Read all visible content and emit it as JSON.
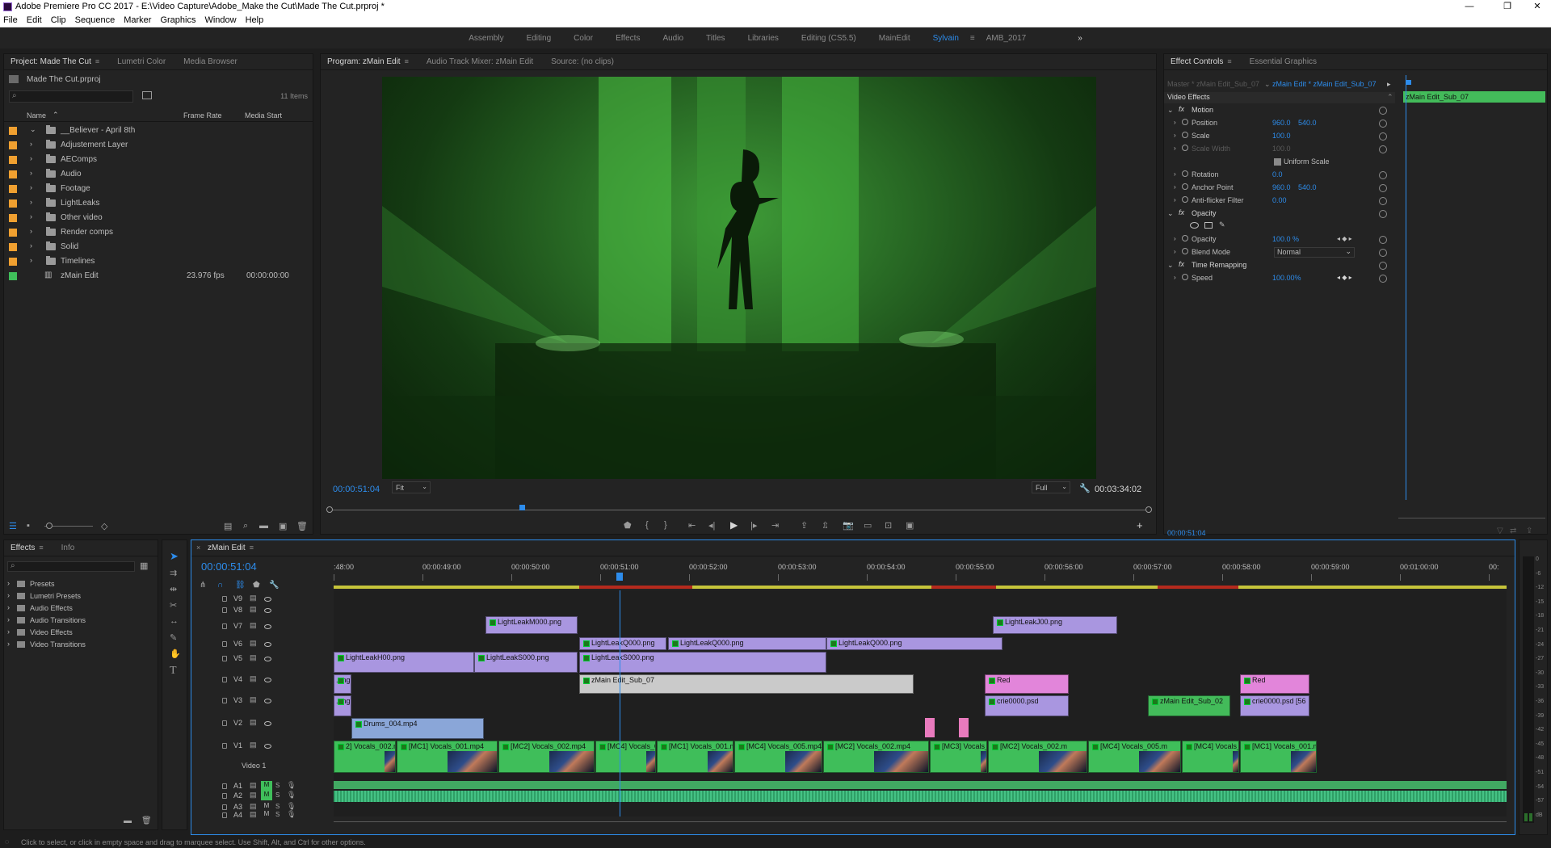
{
  "window": {
    "title": "Adobe Premiere Pro CC 2017 - E:\\Video Capture\\Adobe_Make the Cut\\Made The Cut.prproj *",
    "controls": [
      "—",
      "❐",
      "✕"
    ]
  },
  "menu": [
    "File",
    "Edit",
    "Clip",
    "Sequence",
    "Marker",
    "Graphics",
    "Window",
    "Help"
  ],
  "workspaces": {
    "items": [
      "Assembly",
      "Editing",
      "Color",
      "Effects",
      "Audio",
      "Titles",
      "Libraries",
      "Editing (CS5.5)",
      "MainEdit",
      "Sylvain",
      "AMB_2017"
    ],
    "active": "Sylvain",
    "more": "»"
  },
  "project": {
    "tabs": [
      "Project: Made The Cut",
      "Lumetri Color",
      "Media Browser"
    ],
    "file": "Made The Cut.prproj",
    "items_count": "11 Items",
    "columns": [
      "Name",
      "Frame Rate",
      "Media Start"
    ],
    "rows": [
      {
        "name": "__Believer - April 8th",
        "color": "#f0a030",
        "fps": "",
        "start": "",
        "expanded": true
      },
      {
        "name": "Adjustement Layer",
        "color": "#f0a030",
        "fps": "",
        "start": ""
      },
      {
        "name": "AEComps",
        "color": "#f0a030",
        "fps": "",
        "start": ""
      },
      {
        "name": "Audio",
        "color": "#f0a030",
        "fps": "",
        "start": ""
      },
      {
        "name": "Footage",
        "color": "#f0a030",
        "fps": "",
        "start": ""
      },
      {
        "name": "LightLeaks",
        "color": "#f0a030",
        "fps": "",
        "start": ""
      },
      {
        "name": "Other video",
        "color": "#f0a030",
        "fps": "",
        "start": ""
      },
      {
        "name": "Render comps",
        "color": "#f0a030",
        "fps": "",
        "start": ""
      },
      {
        "name": "Solid",
        "color": "#f0a030",
        "fps": "",
        "start": ""
      },
      {
        "name": "Timelines",
        "color": "#f0a030",
        "fps": "",
        "start": ""
      },
      {
        "name": "zMain Edit",
        "color": "#3fbe5a",
        "fps": "23.976 fps",
        "start": "00:00:00:00",
        "sequence": true
      }
    ]
  },
  "program": {
    "tabs": [
      "Program: zMain Edit",
      "Audio Track Mixer: zMain Edit",
      "Source: (no clips)"
    ],
    "timecode": "00:00:51:04",
    "fit": "Fit",
    "quality": "Full",
    "duration": "00:03:34:02",
    "playhead_fraction": 0.235
  },
  "effect_controls": {
    "tabs": [
      "Effect Controls",
      "Essential Graphics"
    ],
    "source": "Master * zMain Edit_Sub_07",
    "sequence_link": "zMain Edit * zMain Edit_Sub_07",
    "clip_label": "zMain Edit_Sub_07",
    "section": "Video Effects",
    "timecode": "00:00:51:04",
    "rows": [
      {
        "label": "Motion",
        "type": "fx"
      },
      {
        "label": "Position",
        "v1": "960.0",
        "v2": "540.0"
      },
      {
        "label": "Scale",
        "v1": "100.0"
      },
      {
        "label": "Scale Width",
        "v1": "100.0",
        "disabled": true
      },
      {
        "label": "Uniform Scale",
        "type": "check"
      },
      {
        "label": "Rotation",
        "v1": "0.0"
      },
      {
        "label": "Anchor Point",
        "v1": "960.0",
        "v2": "540.0"
      },
      {
        "label": "Anti-flicker Filter",
        "v1": "0.00"
      },
      {
        "label": "Opacity",
        "type": "fx"
      },
      {
        "label": "",
        "type": "masks"
      },
      {
        "label": "Opacity",
        "v1": "100.0 %"
      },
      {
        "label": "Blend Mode",
        "v1": "Normal",
        "type": "select"
      },
      {
        "label": "Time Remapping",
        "type": "fx"
      },
      {
        "label": "Speed",
        "v1": "100.00%"
      }
    ]
  },
  "effects_panel": {
    "tabs": [
      "Effects",
      "Info"
    ],
    "items": [
      "Presets",
      "Lumetri Presets",
      "Audio Effects",
      "Audio Transitions",
      "Video Effects",
      "Video Transitions"
    ]
  },
  "timeline": {
    "tab": "zMain Edit",
    "timecode": "00:00:51:04",
    "ruler": [
      ":48:00",
      "00:00:49:00",
      "00:00:50:00",
      "00:00:51:00",
      "00:00:52:00",
      "00:00:53:00",
      "00:00:54:00",
      "00:00:55:00",
      "00:00:56:00",
      "00:00:57:00",
      "00:00:58:00",
      "00:00:59:00",
      "00:01:00:00",
      "00:"
    ],
    "tracks": [
      "V9",
      "V8",
      "V7",
      "V6",
      "V5",
      "V4",
      "V3",
      "V2",
      "V1",
      "A1",
      "A2",
      "A3",
      "A4"
    ],
    "v1_sublabel": "Video 1",
    "clip_labels": {
      "v7a": "LightLeakM000.png",
      "v7b": "LightLeakJ00.png",
      "v6a": "LightLeakQ000.png",
      "v6b": "LightLeakQ000.png",
      "v6c": "LightLeakQ000.png",
      "v5a": "LightLeakH00.png",
      "v5b": "LightLeakS000.png",
      "v5c": "LightLeakS000.png",
      "v4a": ".png",
      "v4b": "zMain Edit_Sub_07",
      "v4c": "Red",
      "v4d": "Red",
      "v3a": ".png",
      "v3b": "crie0000.psd",
      "v3c": "zMain Edit_Sub_02",
      "v3d": "crie0000.psd [56",
      "v2a": "Drums_004.mp4",
      "v1": [
        "2] Vocals_002.mp4",
        "[MC1] Vocals_001.mp4",
        "[MC2] Vocals_002.mp4",
        "[MC4] Vocals_005",
        "[MC1] Vocals_001.mp4",
        "[MC4] Vocals_005.mp4",
        "[MC2] Vocals_002.mp4",
        "[MC3] Vocals_003.mp4",
        "[MC2] Vocals_002.m",
        "[MC4] Vocals_005.m",
        "[MC4] Vocals_005.mp4",
        "[MC1] Vocals_001.mp4"
      ]
    }
  },
  "meter_scale": [
    "0",
    "-6",
    "-12",
    "-15",
    "-18",
    "-21",
    "-24",
    "-27",
    "-30",
    "-33",
    "-36",
    "-39",
    "-42",
    "-45",
    "-48",
    "-51",
    "-54",
    "-57",
    "dB"
  ],
  "status": "Click to select, or click in empty space and drag to marquee select. Use Shift, Alt, and Ctrl for other options."
}
